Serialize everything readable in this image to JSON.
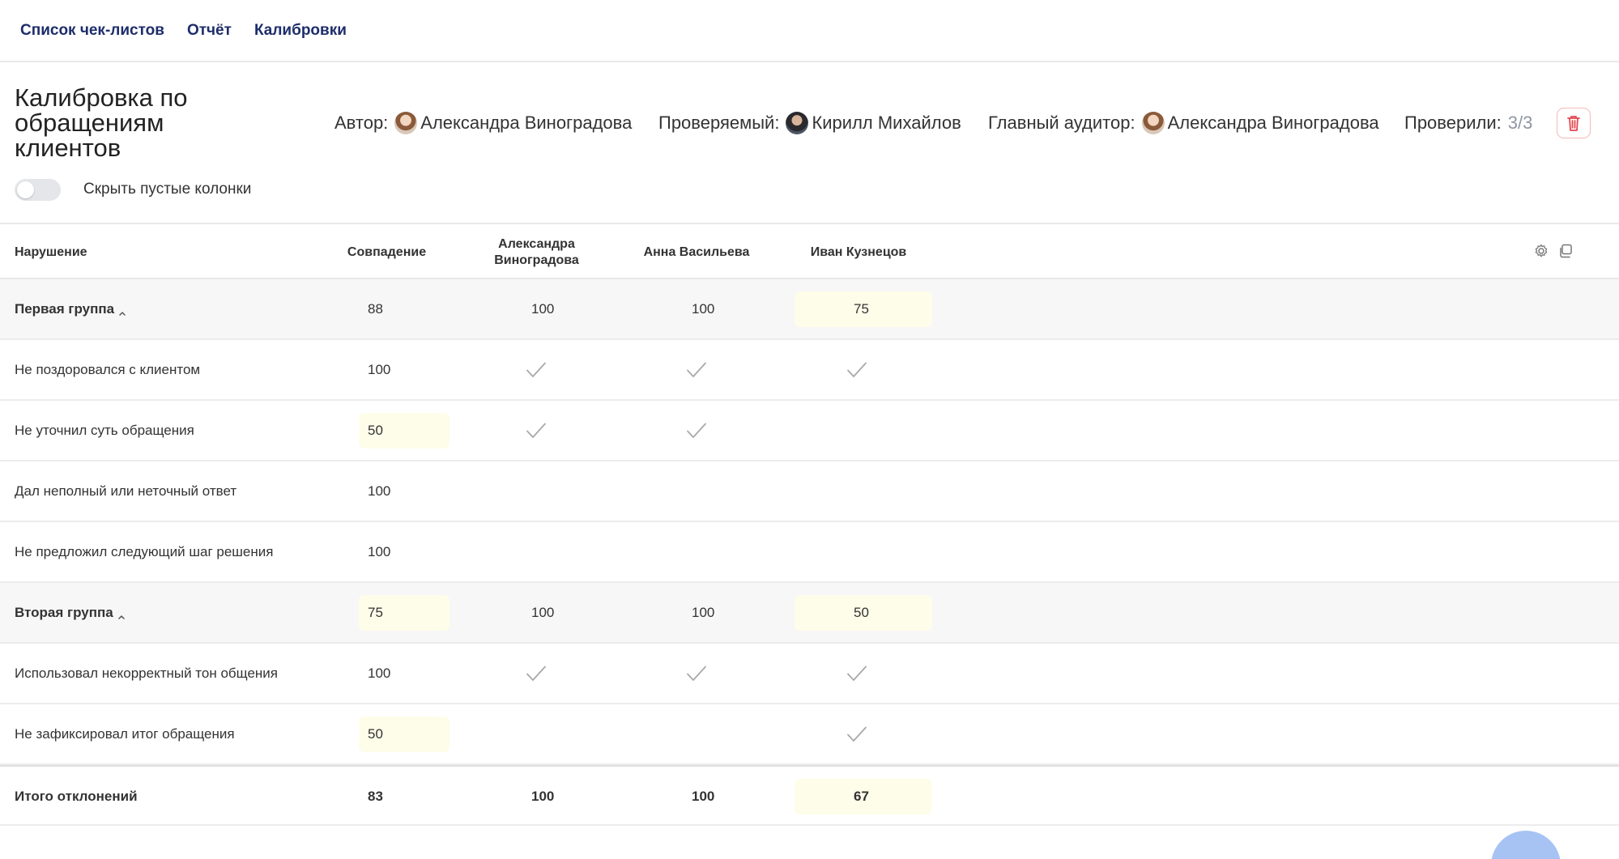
{
  "nav": [
    "Список чек-листов",
    "Отчёт",
    "Калибровки"
  ],
  "header": {
    "title": "Калибровка по обращениям клиентов",
    "author_label": "Автор:",
    "author_name": "Александра Виноградова",
    "reviewee_label": "Проверяемый:",
    "reviewee_name": "Кирилл Михайлов",
    "auditor_label": "Главный аудитор:",
    "auditor_name": "Александра Виноградова",
    "checked_label": "Проверили:",
    "checked_count": "3/3",
    "toggle_label": "Скрыть пустые колонки",
    "toggle_on": false
  },
  "table": {
    "columns": [
      "Нарушение",
      "Совпадение",
      "Александра Виноградова",
      "Анна Васильева",
      "Иван Кузнецов"
    ],
    "column_lines": [
      [
        "Нарушение"
      ],
      [
        "Совпадение"
      ],
      [
        "Александра",
        "Виноградова"
      ],
      [
        "Анна Васильева"
      ],
      [
        "Иван Кузнецов"
      ]
    ],
    "rows": [
      {
        "type": "group",
        "label": "Первая группа",
        "match": "88",
        "match_hl": false,
        "a": "100",
        "b": "100",
        "c": "75",
        "c_hl": true
      },
      {
        "type": "item",
        "label": "Не поздоровался с клиентом",
        "match": "100",
        "match_hl": false,
        "a_check": true,
        "b_check": true,
        "c_check": true
      },
      {
        "type": "item",
        "label": "Не уточнил суть обращения",
        "match": "50",
        "match_hl": true,
        "a_check": true,
        "b_check": true,
        "c_check": false
      },
      {
        "type": "item",
        "label": "Дал неполный или неточный ответ",
        "match": "100",
        "match_hl": false,
        "a_check": false,
        "b_check": false,
        "c_check": false
      },
      {
        "type": "item",
        "label": "Не предложил следующий шаг решения",
        "match": "100",
        "match_hl": false,
        "a_check": false,
        "b_check": false,
        "c_check": false
      },
      {
        "type": "group",
        "label": "Вторая группа",
        "match": "75",
        "match_hl": true,
        "a": "100",
        "b": "100",
        "c": "50",
        "c_hl": true
      },
      {
        "type": "item",
        "label": "Использовал некорректный тон общения",
        "match": "100",
        "match_hl": false,
        "a_check": true,
        "b_check": true,
        "c_check": true
      },
      {
        "type": "item",
        "label": "Не зафиксировал итог обращения",
        "match": "50",
        "match_hl": true,
        "a_check": false,
        "b_check": false,
        "c_check": true
      },
      {
        "type": "total",
        "label": "Итого отклонений",
        "match": "83",
        "match_hl": false,
        "a": "100",
        "b": "100",
        "c": "67",
        "c_hl": true
      }
    ]
  },
  "icons": {
    "delete": "trash-icon",
    "settings": "gear-icon",
    "copy": "copy-icon",
    "collapse": "chevron-up-icon",
    "check": "check-icon"
  },
  "colors": {
    "nav_link": "#1d2d6b",
    "highlight": "#fefdea",
    "delete_red": "#e5484d",
    "fab": "#a6c3f4"
  }
}
